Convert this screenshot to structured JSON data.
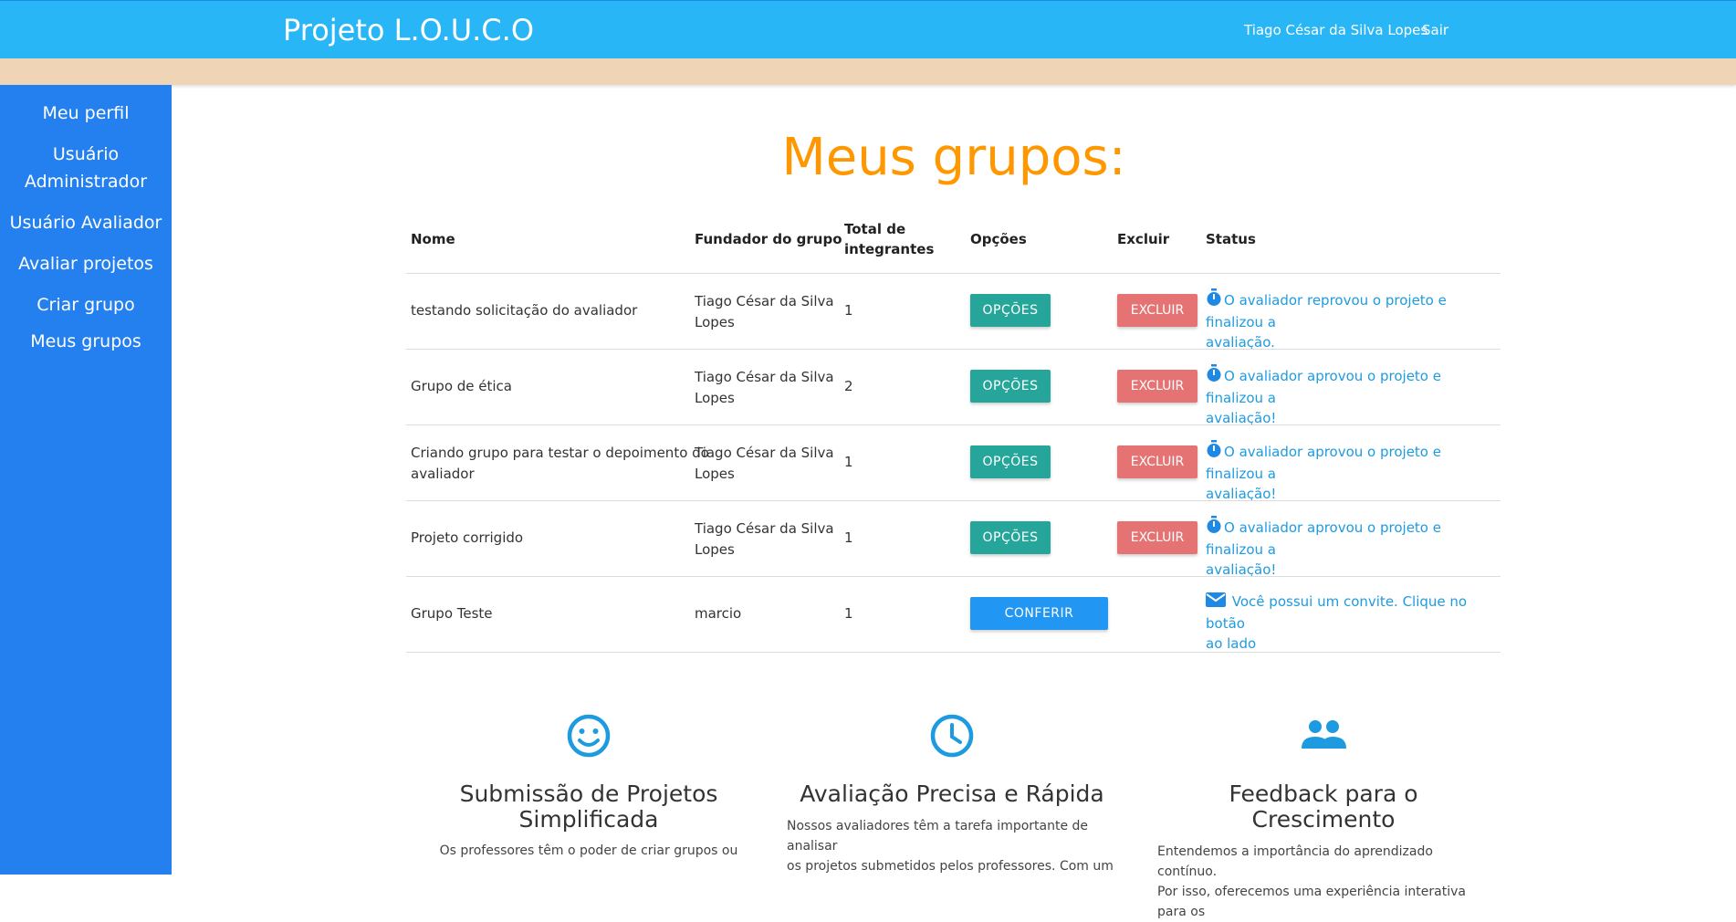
{
  "header": {
    "brand": "Projeto L.O.U.C.O",
    "user_name": "Tiago César da Silva Lopes",
    "logout_label": "Sair"
  },
  "sidebar": {
    "items": [
      {
        "label": "Meu perfil"
      },
      {
        "label_line1": "Usuário",
        "label_line2": "Administrador"
      },
      {
        "label": "Usuário Avaliador"
      },
      {
        "label": "Avaliar projetos"
      },
      {
        "label": "Criar grupo"
      },
      {
        "label": "Meus grupos"
      }
    ]
  },
  "page": {
    "title": "Meus grupos:"
  },
  "table": {
    "headers": {
      "name": "Nome",
      "founder": "Fundador do grupo",
      "total_line1": "Total de",
      "total_line2": "integrantes",
      "options": "Opções",
      "delete": "Excluir",
      "status": "Status"
    },
    "rows": [
      {
        "name_line1": "testando solicitação do avaliador",
        "name_line2": "",
        "founder_line1": "Tiago César da Silva",
        "founder_line2": "Lopes",
        "total": "1",
        "options_label": "OPÇÕES",
        "delete_label": "EXCLUIR",
        "status_line1": "O avaliador reprovou o projeto e finalizou a",
        "status_line2": "avaliação."
      },
      {
        "name_line1": "Grupo de ética",
        "name_line2": "",
        "founder_line1": "Tiago César da Silva",
        "founder_line2": "Lopes",
        "total": "2",
        "options_label": "OPÇÕES",
        "delete_label": "EXCLUIR",
        "status_line1": "O avaliador aprovou o projeto e finalizou a",
        "status_line2": "avaliação!"
      },
      {
        "name_line1": "Criando grupo para testar o depoimento do",
        "name_line2": "avaliador",
        "founder_line1": "Tiago César da Silva",
        "founder_line2": "Lopes",
        "total": "1",
        "options_label": "OPÇÕES",
        "delete_label": "EXCLUIR",
        "status_line1": "O avaliador aprovou o projeto e finalizou a",
        "status_line2": "avaliação!"
      },
      {
        "name_line1": "Projeto corrigido",
        "name_line2": "",
        "founder_line1": "Tiago César da Silva",
        "founder_line2": "Lopes",
        "total": "1",
        "options_label": "OPÇÕES",
        "delete_label": "EXCLUIR",
        "status_line1": "O avaliador aprovou o projeto e finalizou a",
        "status_line2": "avaliação!"
      },
      {
        "name_line1": "Grupo Teste",
        "name_line2": "",
        "founder_line1": "marcio",
        "founder_line2": "",
        "total": "1",
        "confirm_label": "CONFERIR",
        "status_line1": "Você possui um convite. Clique no botão",
        "status_line2": "ao lado"
      }
    ]
  },
  "features": [
    {
      "icon": "smiley-icon",
      "title_line1": "Submissão de Projetos",
      "title_line2": "Simplificada",
      "desc_line1": "Os professores têm o poder de criar grupos ou"
    },
    {
      "icon": "clock-icon",
      "title_line1": "Avaliação Precisa e Rápida",
      "desc_line1": "Nossos avaliadores têm a tarefa importante de analisar",
      "desc_line2": "os projetos submetidos pelos professores. Com um"
    },
    {
      "icon": "group-icon",
      "title_line1": "Feedback para o Crescimento",
      "desc_line1": "Entendemos a importância do aprendizado contínuo.",
      "desc_line2": "Por isso, oferecemos uma experiência interativa para os"
    }
  ],
  "colors": {
    "topbar": "#29b6f6",
    "sidebar": "#2480ee",
    "heading": "#ff9800",
    "options_button": "#26a69a",
    "delete_button": "#e57373",
    "confirm_button": "#2196f3",
    "status_text": "#1e9be0"
  }
}
